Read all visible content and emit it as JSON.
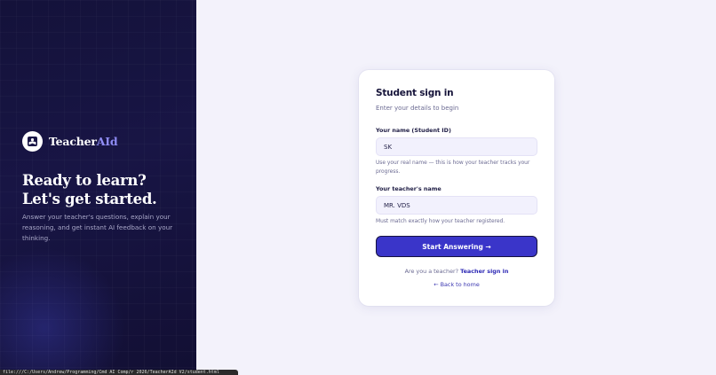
{
  "brand": {
    "name_main": "Teacher",
    "name_accent": "AId",
    "logo_icon": "reading-book-icon"
  },
  "hero": {
    "headline_line1": "Ready to learn?",
    "headline_line2": "Let's get started.",
    "description": "Answer your teacher's questions, explain your reasoning, and get instant AI feedback on your thinking."
  },
  "form": {
    "title": "Student sign in",
    "subtitle": "Enter your details to begin",
    "name_field": {
      "label": "Your name (Student ID)",
      "value": "SK",
      "help": "Use your real name — this is how your teacher tracks your progress."
    },
    "teacher_field": {
      "label": "Your teacher's name",
      "value": "MR. VDS",
      "help": "Must match exactly how your teacher registered."
    },
    "submit_label": "Start Answering →",
    "teacher_prompt": "Are you a teacher?",
    "teacher_link": "Teacher sign in",
    "back_link": "← Back to home"
  },
  "status_bar": {
    "text": "file:///C:/Users/Andrew/Programming/Cmd AI Comp/r 2026/TeacherAId V2/student.html"
  },
  "colors": {
    "accent": "#3a35c9",
    "brand_accent": "#8f8cf5",
    "panel_dark": "#14123a",
    "page_bg": "#f3f2fb"
  }
}
